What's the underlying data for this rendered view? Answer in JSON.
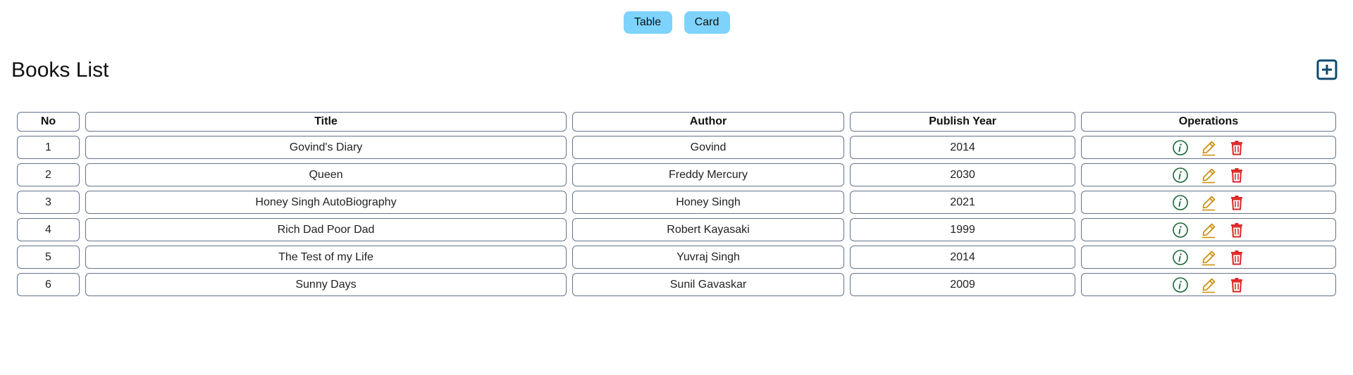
{
  "view_toggle": {
    "table_label": "Table",
    "card_label": "Card"
  },
  "page": {
    "title": "Books List",
    "add_icon": "plus-square-icon"
  },
  "table": {
    "headers": [
      "No",
      "Title",
      "Author",
      "Publish Year",
      "Operations"
    ],
    "rows": [
      {
        "no": "1",
        "title": "Govind's Diary",
        "author": "Govind",
        "year": "2014"
      },
      {
        "no": "2",
        "title": "Queen",
        "author": "Freddy Mercury",
        "year": "2030"
      },
      {
        "no": "3",
        "title": "Honey Singh AutoBiography",
        "author": "Honey Singh",
        "year": "2021"
      },
      {
        "no": "4",
        "title": "Rich Dad Poor Dad",
        "author": "Robert Kayasaki",
        "year": "1999"
      },
      {
        "no": "5",
        "title": "The Test of my Life",
        "author": "Yuvraj Singh",
        "year": "2014"
      },
      {
        "no": "6",
        "title": "Sunny Days",
        "author": "Sunil Gavaskar",
        "year": "2009"
      }
    ],
    "operation_icons": [
      "info-circle-icon",
      "pencil-edit-icon",
      "trash-delete-icon"
    ]
  },
  "colors": {
    "toggle_button_bg": "#7dd3fc",
    "add_icon": "#0c4a6e",
    "info_icon": "#166534",
    "edit_icon": "#ca8a04",
    "delete_icon": "#dc2626",
    "cell_border": "#64748b"
  }
}
